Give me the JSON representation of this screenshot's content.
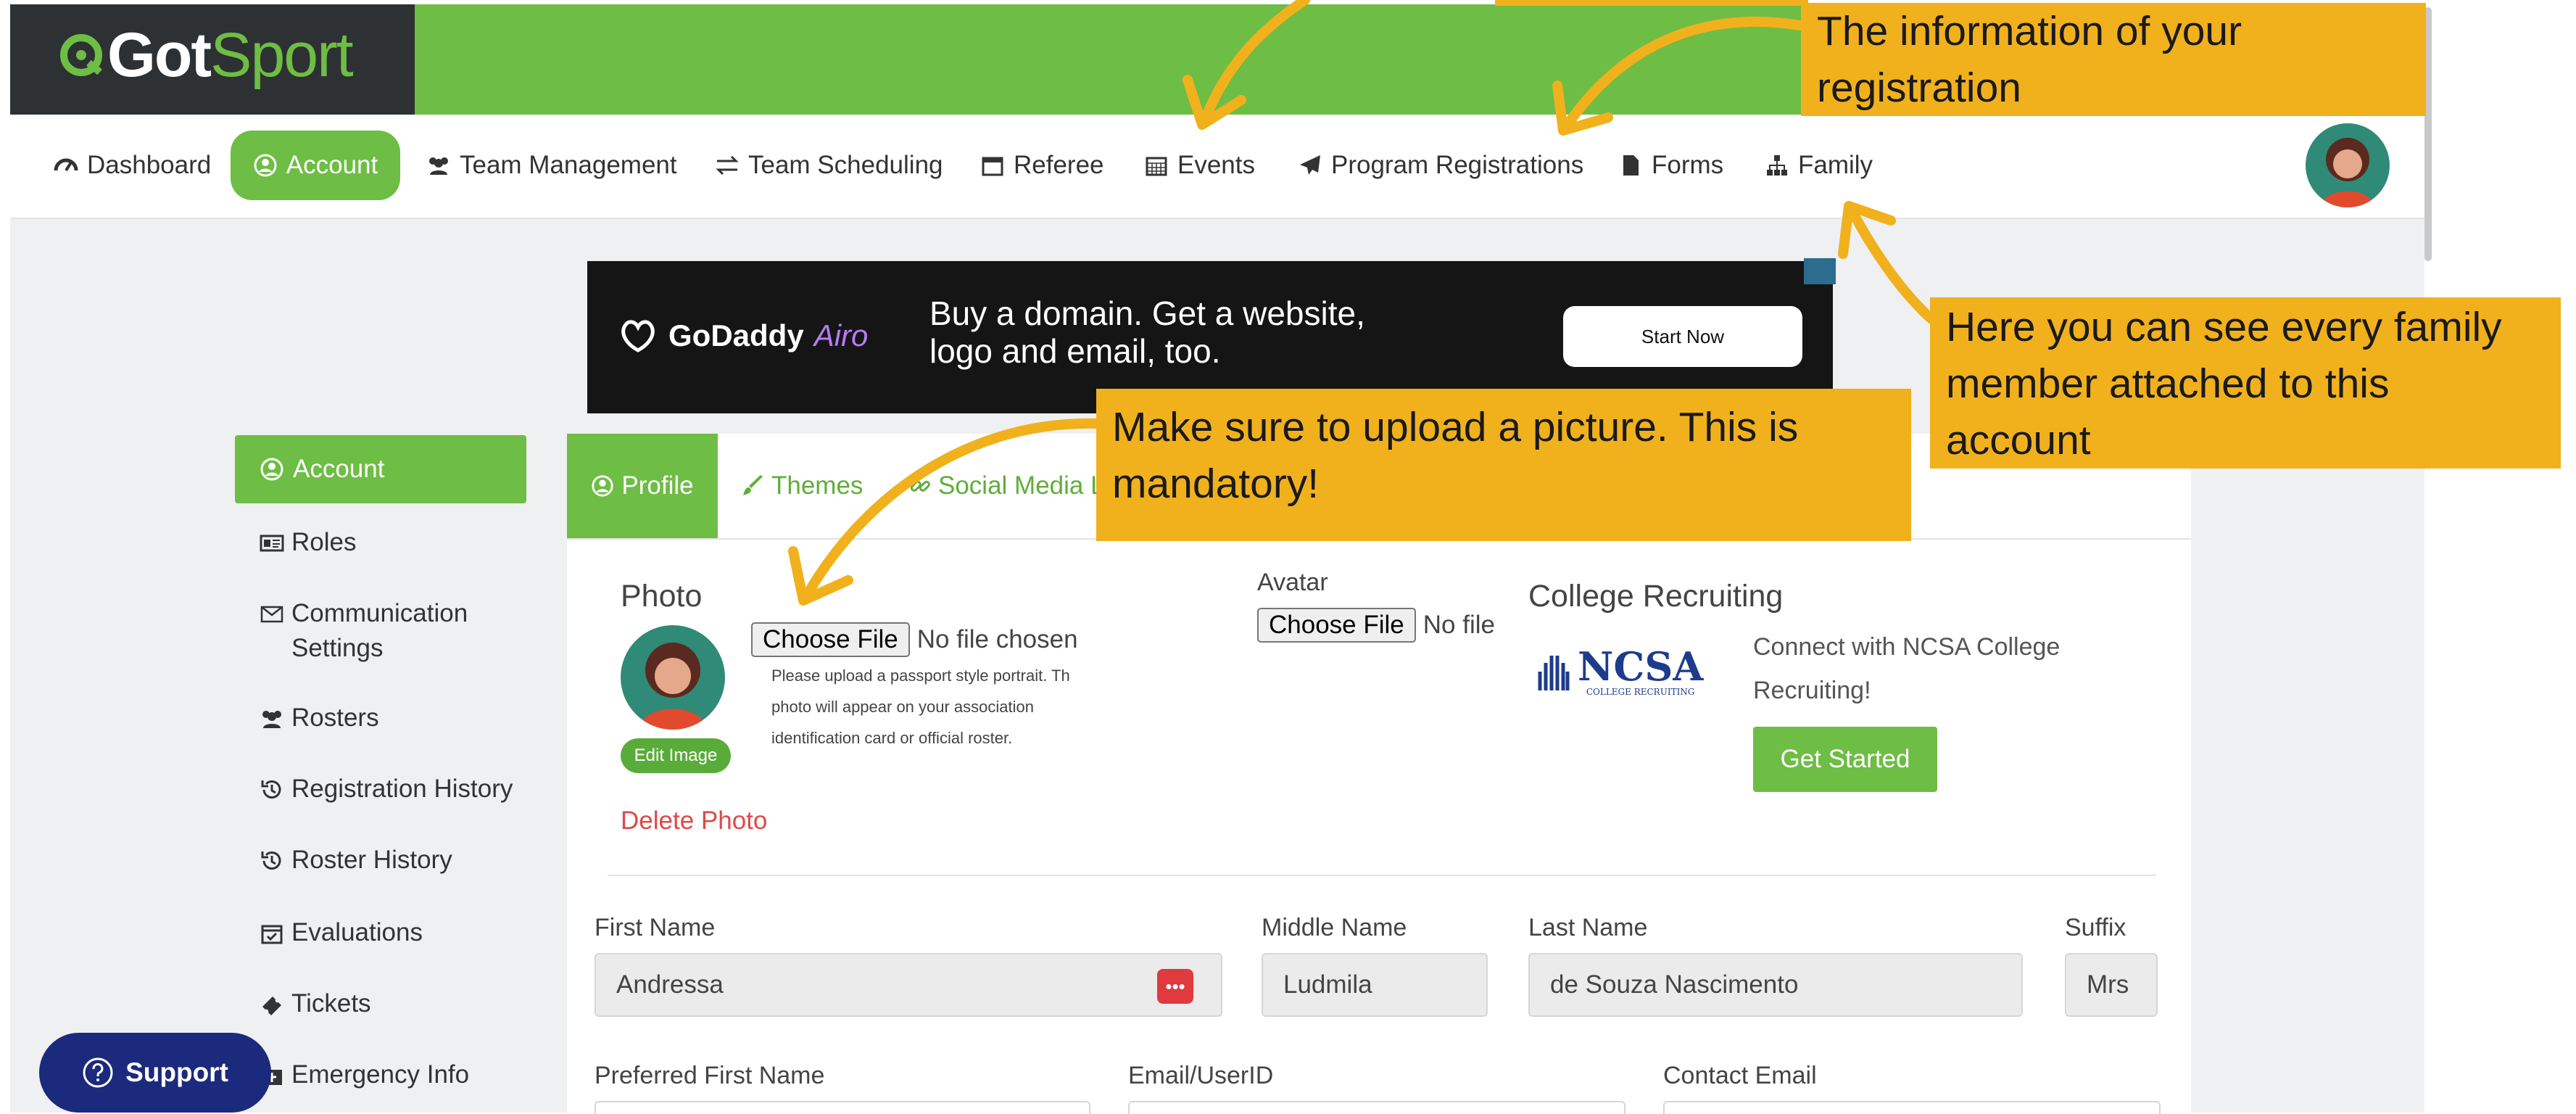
{
  "brand": {
    "logo_part1": "Got",
    "logo_part2": "Sport"
  },
  "nav": {
    "items": [
      {
        "label": "Dashboard",
        "icon": "dashboard-icon"
      },
      {
        "label": "Account",
        "icon": "user-circle-icon"
      },
      {
        "label": "Team Management",
        "icon": "users-icon"
      },
      {
        "label": "Team Scheduling",
        "icon": "exchange-icon"
      },
      {
        "label": "Referee",
        "icon": "calendar-icon"
      },
      {
        "label": "Events",
        "icon": "calendar-grid-icon"
      },
      {
        "label": "Program Registrations",
        "icon": "paper-plane-icon"
      },
      {
        "label": "Forms",
        "icon": "file-icon"
      },
      {
        "label": "Family",
        "icon": "sitemap-icon"
      }
    ],
    "active": "Account"
  },
  "ad": {
    "brand": "GoDaddy",
    "product": "Airo",
    "text": "Buy a domain. Get a website, logo and email, too.",
    "cta": "Start Now"
  },
  "sidebar": {
    "items": [
      {
        "label": "Account",
        "icon": "user-circle-icon"
      },
      {
        "label": "Roles",
        "icon": "id-card-icon"
      },
      {
        "label": "Communication Settings",
        "icon": "envelope-icon"
      },
      {
        "label": "Rosters",
        "icon": "users-icon"
      },
      {
        "label": "Registration History",
        "icon": "history-icon"
      },
      {
        "label": "Roster History",
        "icon": "history-icon"
      },
      {
        "label": "Evaluations",
        "icon": "calendar-check-icon"
      },
      {
        "label": "Tickets",
        "icon": "ticket-icon"
      },
      {
        "label": "Emergency Info",
        "icon": "medkit-icon"
      }
    ]
  },
  "tabs": [
    {
      "label": "Profile",
      "icon": "user-circle-icon"
    },
    {
      "label": "Themes",
      "icon": "brush-icon"
    },
    {
      "label": "Social Media L",
      "icon": "link-icon"
    }
  ],
  "profile": {
    "photo_label": "Photo",
    "choose_file": "Choose File",
    "no_file": "No file chosen",
    "photo_help": [
      "Please upload a passport style portrait. Th",
      "photo will appear on your association",
      "identification card or official roster."
    ],
    "edit_image": "Edit Image",
    "delete_photo": "Delete Photo",
    "avatar_label": "Avatar",
    "avatar_no_file": "No file",
    "college_title": "College Recruiting",
    "ncsa_logo": "NCSA",
    "ncsa_sub": "COLLEGE RECRUITING",
    "ncsa_text": "Connect with NCSA College Recruiting!",
    "get_started": "Get Started"
  },
  "fields": {
    "first_name_label": "First Name",
    "first_name": "Andressa",
    "middle_name_label": "Middle Name",
    "middle_name": "Ludmila",
    "last_name_label": "Last Name",
    "last_name": "de Souza Nascimento",
    "suffix_label": "Suffix",
    "suffix": "Mrs",
    "preferred_label": "Preferred First Name",
    "email_label": "Email/UserID",
    "contact_label": "Contact Email"
  },
  "support": {
    "label": "Support"
  },
  "annotations": {
    "registration": "The information of your registration",
    "family": "Here you can see every family member attached to this account",
    "photo": "Make sure to upload a picture. This is mandatory!"
  },
  "colors": {
    "brand_green": "#6ebd44",
    "dark": "#2d3133",
    "callout": "#f1b11d",
    "support": "#1b2a7c",
    "danger": "#e04848"
  }
}
